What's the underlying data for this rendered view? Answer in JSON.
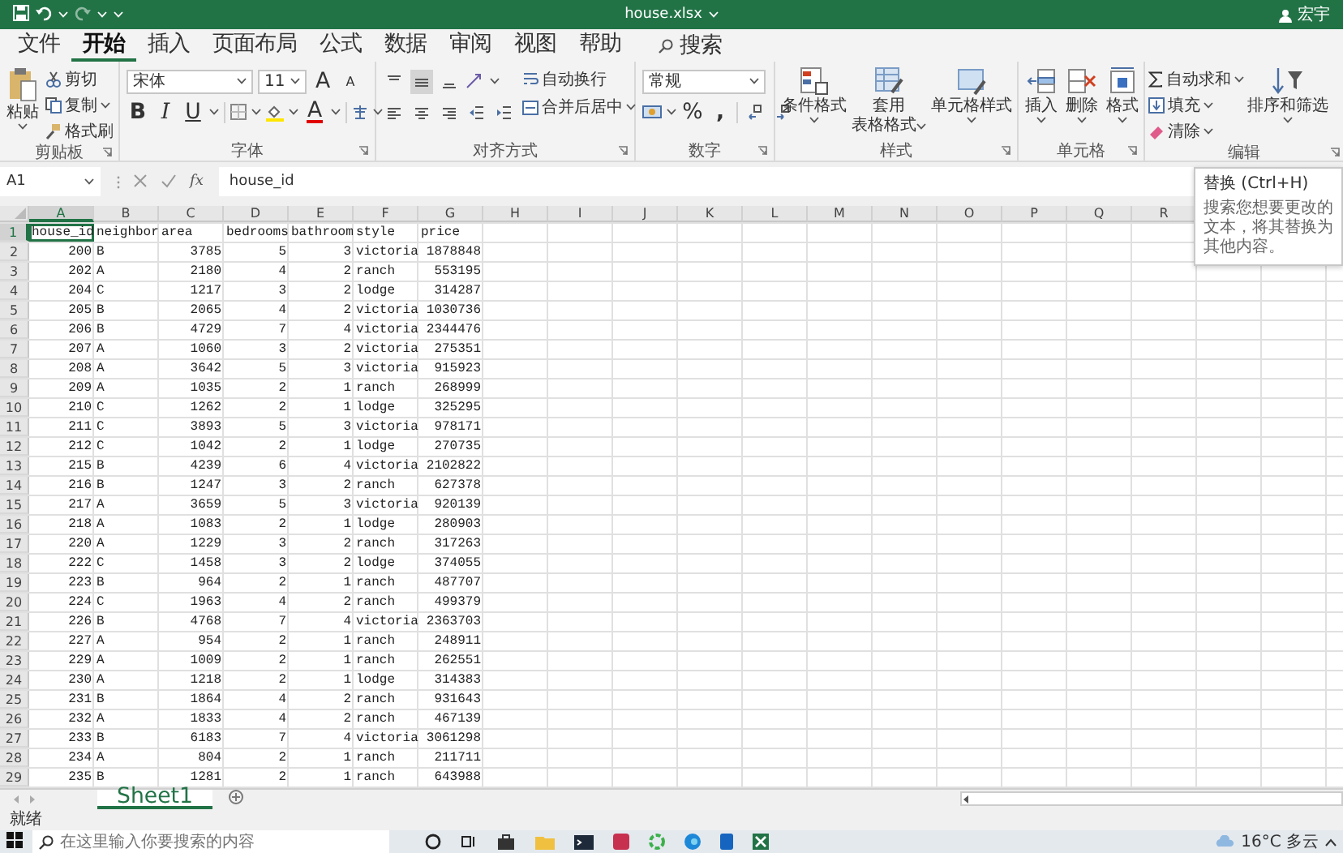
{
  "title_bar": {
    "title": "house.xlsx",
    "user": "宏宇"
  },
  "menu_tabs": [
    {
      "label": "文件",
      "selected": false
    },
    {
      "label": "开始",
      "selected": true
    },
    {
      "label": "插入",
      "selected": false
    },
    {
      "label": "页面布局",
      "selected": false
    },
    {
      "label": "公式",
      "selected": false
    },
    {
      "label": "数据",
      "selected": false
    },
    {
      "label": "审阅",
      "selected": false
    },
    {
      "label": "视图",
      "selected": false
    },
    {
      "label": "帮助",
      "selected": false
    }
  ],
  "search": {
    "label": "搜索"
  },
  "ribbon": {
    "clipboard": {
      "label": "剪贴板",
      "paste": "粘贴",
      "cut": "剪切",
      "copy": "复制",
      "format_painter": "格式刷"
    },
    "font": {
      "label": "字体",
      "font_name": "宋体",
      "font_size": "11",
      "grow": "A",
      "shrink": "A",
      "bold": "B",
      "italic": "I",
      "underline": "U",
      "font_color": "A"
    },
    "alignment": {
      "label": "对齐方式",
      "vertical_align": [
        {
          "selected": false
        },
        {
          "selected": true
        },
        {
          "selected": false
        }
      ],
      "wrap_text": "自动换行",
      "merge_center": "合并后居中"
    },
    "number": {
      "label": "数字",
      "format": "常规",
      "percent": "%",
      "comma": ","
    },
    "styles": {
      "label": "样式",
      "conditional": "条件格式",
      "table_lines": [
        "套用",
        "表格格式"
      ],
      "cell_styles": "单元格样式"
    },
    "cells": {
      "label": "单元格",
      "insert": "插入",
      "delete": "删除",
      "format": "格式"
    },
    "editing": {
      "label": "编辑",
      "autosum": "自动求和",
      "fill": "填充",
      "clear": "清除",
      "sort_filter": "排序和筛选"
    }
  },
  "tooltip": {
    "title": "替换 (Ctrl+H)",
    "body": "搜索您想要更改的文本，将其替换为其他内容。"
  },
  "sheet": {
    "name_box": "A1",
    "formula_button": "fx",
    "formula": "house_id",
    "columns": [
      {
        "label": "A",
        "selected": true,
        "kind": "number"
      },
      {
        "label": "B",
        "selected": false,
        "kind": "text"
      },
      {
        "label": "C",
        "selected": false,
        "kind": "number"
      },
      {
        "label": "D",
        "selected": false,
        "kind": "number"
      },
      {
        "label": "E",
        "selected": false,
        "kind": "number"
      },
      {
        "label": "F",
        "selected": false,
        "kind": "text"
      },
      {
        "label": "G",
        "selected": false,
        "kind": "number"
      },
      {
        "label": "H",
        "selected": false
      },
      {
        "label": "I",
        "selected": false
      },
      {
        "label": "J",
        "selected": false
      },
      {
        "label": "K",
        "selected": false
      },
      {
        "label": "L",
        "selected": false
      },
      {
        "label": "M",
        "selected": false
      },
      {
        "label": "N",
        "selected": false
      },
      {
        "label": "O",
        "selected": false
      },
      {
        "label": "P",
        "selected": false
      },
      {
        "label": "Q",
        "selected": false
      },
      {
        "label": "R",
        "selected": false
      }
    ],
    "rows": [
      {
        "label": "1",
        "selected": true,
        "kind": "header",
        "cells": [
          "house_id",
          "neighbor",
          "area",
          "bedrooms",
          "bathroom",
          "style",
          "price"
        ]
      },
      {
        "label": "2",
        "selected": false,
        "kind": "data",
        "cells": [
          "200",
          "B",
          "3785",
          "5",
          "3",
          "victoria",
          "1878848"
        ]
      },
      {
        "label": "3",
        "selected": false,
        "kind": "data",
        "cells": [
          "202",
          "A",
          "2180",
          "4",
          "2",
          "ranch",
          "553195"
        ]
      },
      {
        "label": "4",
        "selected": false,
        "kind": "data",
        "cells": [
          "204",
          "C",
          "1217",
          "3",
          "2",
          "lodge",
          "314287"
        ]
      },
      {
        "label": "5",
        "selected": false,
        "kind": "data",
        "cells": [
          "205",
          "B",
          "2065",
          "4",
          "2",
          "victoria",
          "1030736"
        ]
      },
      {
        "label": "6",
        "selected": false,
        "kind": "data",
        "cells": [
          "206",
          "B",
          "4729",
          "7",
          "4",
          "victoria",
          "2344476"
        ]
      },
      {
        "label": "7",
        "selected": false,
        "kind": "data",
        "cells": [
          "207",
          "A",
          "1060",
          "3",
          "2",
          "victoria",
          "275351"
        ]
      },
      {
        "label": "8",
        "selected": false,
        "kind": "data",
        "cells": [
          "208",
          "A",
          "3642",
          "5",
          "3",
          "victoria",
          "915923"
        ]
      },
      {
        "label": "9",
        "selected": false,
        "kind": "data",
        "cells": [
          "209",
          "A",
          "1035",
          "2",
          "1",
          "ranch",
          "268999"
        ]
      },
      {
        "label": "10",
        "selected": false,
        "kind": "data",
        "cells": [
          "210",
          "C",
          "1262",
          "2",
          "1",
          "lodge",
          "325295"
        ]
      },
      {
        "label": "11",
        "selected": false,
        "kind": "data",
        "cells": [
          "211",
          "C",
          "3893",
          "5",
          "3",
          "victoria",
          "978171"
        ]
      },
      {
        "label": "12",
        "selected": false,
        "kind": "data",
        "cells": [
          "212",
          "C",
          "1042",
          "2",
          "1",
          "lodge",
          "270735"
        ]
      },
      {
        "label": "13",
        "selected": false,
        "kind": "data",
        "cells": [
          "215",
          "B",
          "4239",
          "6",
          "4",
          "victoria",
          "2102822"
        ]
      },
      {
        "label": "14",
        "selected": false,
        "kind": "data",
        "cells": [
          "216",
          "B",
          "1247",
          "3",
          "2",
          "ranch",
          "627378"
        ]
      },
      {
        "label": "15",
        "selected": false,
        "kind": "data",
        "cells": [
          "217",
          "A",
          "3659",
          "5",
          "3",
          "victoria",
          "920139"
        ]
      },
      {
        "label": "16",
        "selected": false,
        "kind": "data",
        "cells": [
          "218",
          "A",
          "1083",
          "2",
          "1",
          "lodge",
          "280903"
        ]
      },
      {
        "label": "17",
        "selected": false,
        "kind": "data",
        "cells": [
          "220",
          "A",
          "1229",
          "3",
          "2",
          "ranch",
          "317263"
        ]
      },
      {
        "label": "18",
        "selected": false,
        "kind": "data",
        "cells": [
          "222",
          "C",
          "1458",
          "3",
          "2",
          "lodge",
          "374055"
        ]
      },
      {
        "label": "19",
        "selected": false,
        "kind": "data",
        "cells": [
          "223",
          "B",
          "964",
          "2",
          "1",
          "ranch",
          "487707"
        ]
      },
      {
        "label": "20",
        "selected": false,
        "kind": "data",
        "cells": [
          "224",
          "C",
          "1963",
          "4",
          "2",
          "ranch",
          "499379"
        ]
      },
      {
        "label": "21",
        "selected": false,
        "kind": "data",
        "cells": [
          "226",
          "B",
          "4768",
          "7",
          "4",
          "victoria",
          "2363703"
        ]
      },
      {
        "label": "22",
        "selected": false,
        "kind": "data",
        "cells": [
          "227",
          "A",
          "954",
          "2",
          "1",
          "ranch",
          "248911"
        ]
      },
      {
        "label": "23",
        "selected": false,
        "kind": "data",
        "cells": [
          "229",
          "A",
          "1009",
          "2",
          "1",
          "ranch",
          "262551"
        ]
      },
      {
        "label": "24",
        "selected": false,
        "kind": "data",
        "cells": [
          "230",
          "A",
          "1218",
          "2",
          "1",
          "lodge",
          "314383"
        ]
      },
      {
        "label": "25",
        "selected": false,
        "kind": "data",
        "cells": [
          "231",
          "B",
          "1864",
          "4",
          "2",
          "ranch",
          "931643"
        ]
      },
      {
        "label": "26",
        "selected": false,
        "kind": "data",
        "cells": [
          "232",
          "A",
          "1833",
          "4",
          "2",
          "ranch",
          "467139"
        ]
      },
      {
        "label": "27",
        "selected": false,
        "kind": "data",
        "cells": [
          "233",
          "B",
          "6183",
          "7",
          "4",
          "victoria",
          "3061298"
        ]
      },
      {
        "label": "28",
        "selected": false,
        "kind": "data",
        "cells": [
          "234",
          "A",
          "804",
          "2",
          "1",
          "ranch",
          "211711"
        ]
      },
      {
        "label": "29",
        "selected": false,
        "kind": "data",
        "cells": [
          "235",
          "B",
          "1281",
          "2",
          "1",
          "ranch",
          "643988"
        ]
      }
    ]
  },
  "sheet_tabs": [
    {
      "label": "Sheet1",
      "selected": true
    }
  ],
  "status_bar": {
    "text": "就绪"
  },
  "taskbar": {
    "search_placeholder": "在这里输入你要搜索的内容",
    "weather": "16°C 多云"
  }
}
